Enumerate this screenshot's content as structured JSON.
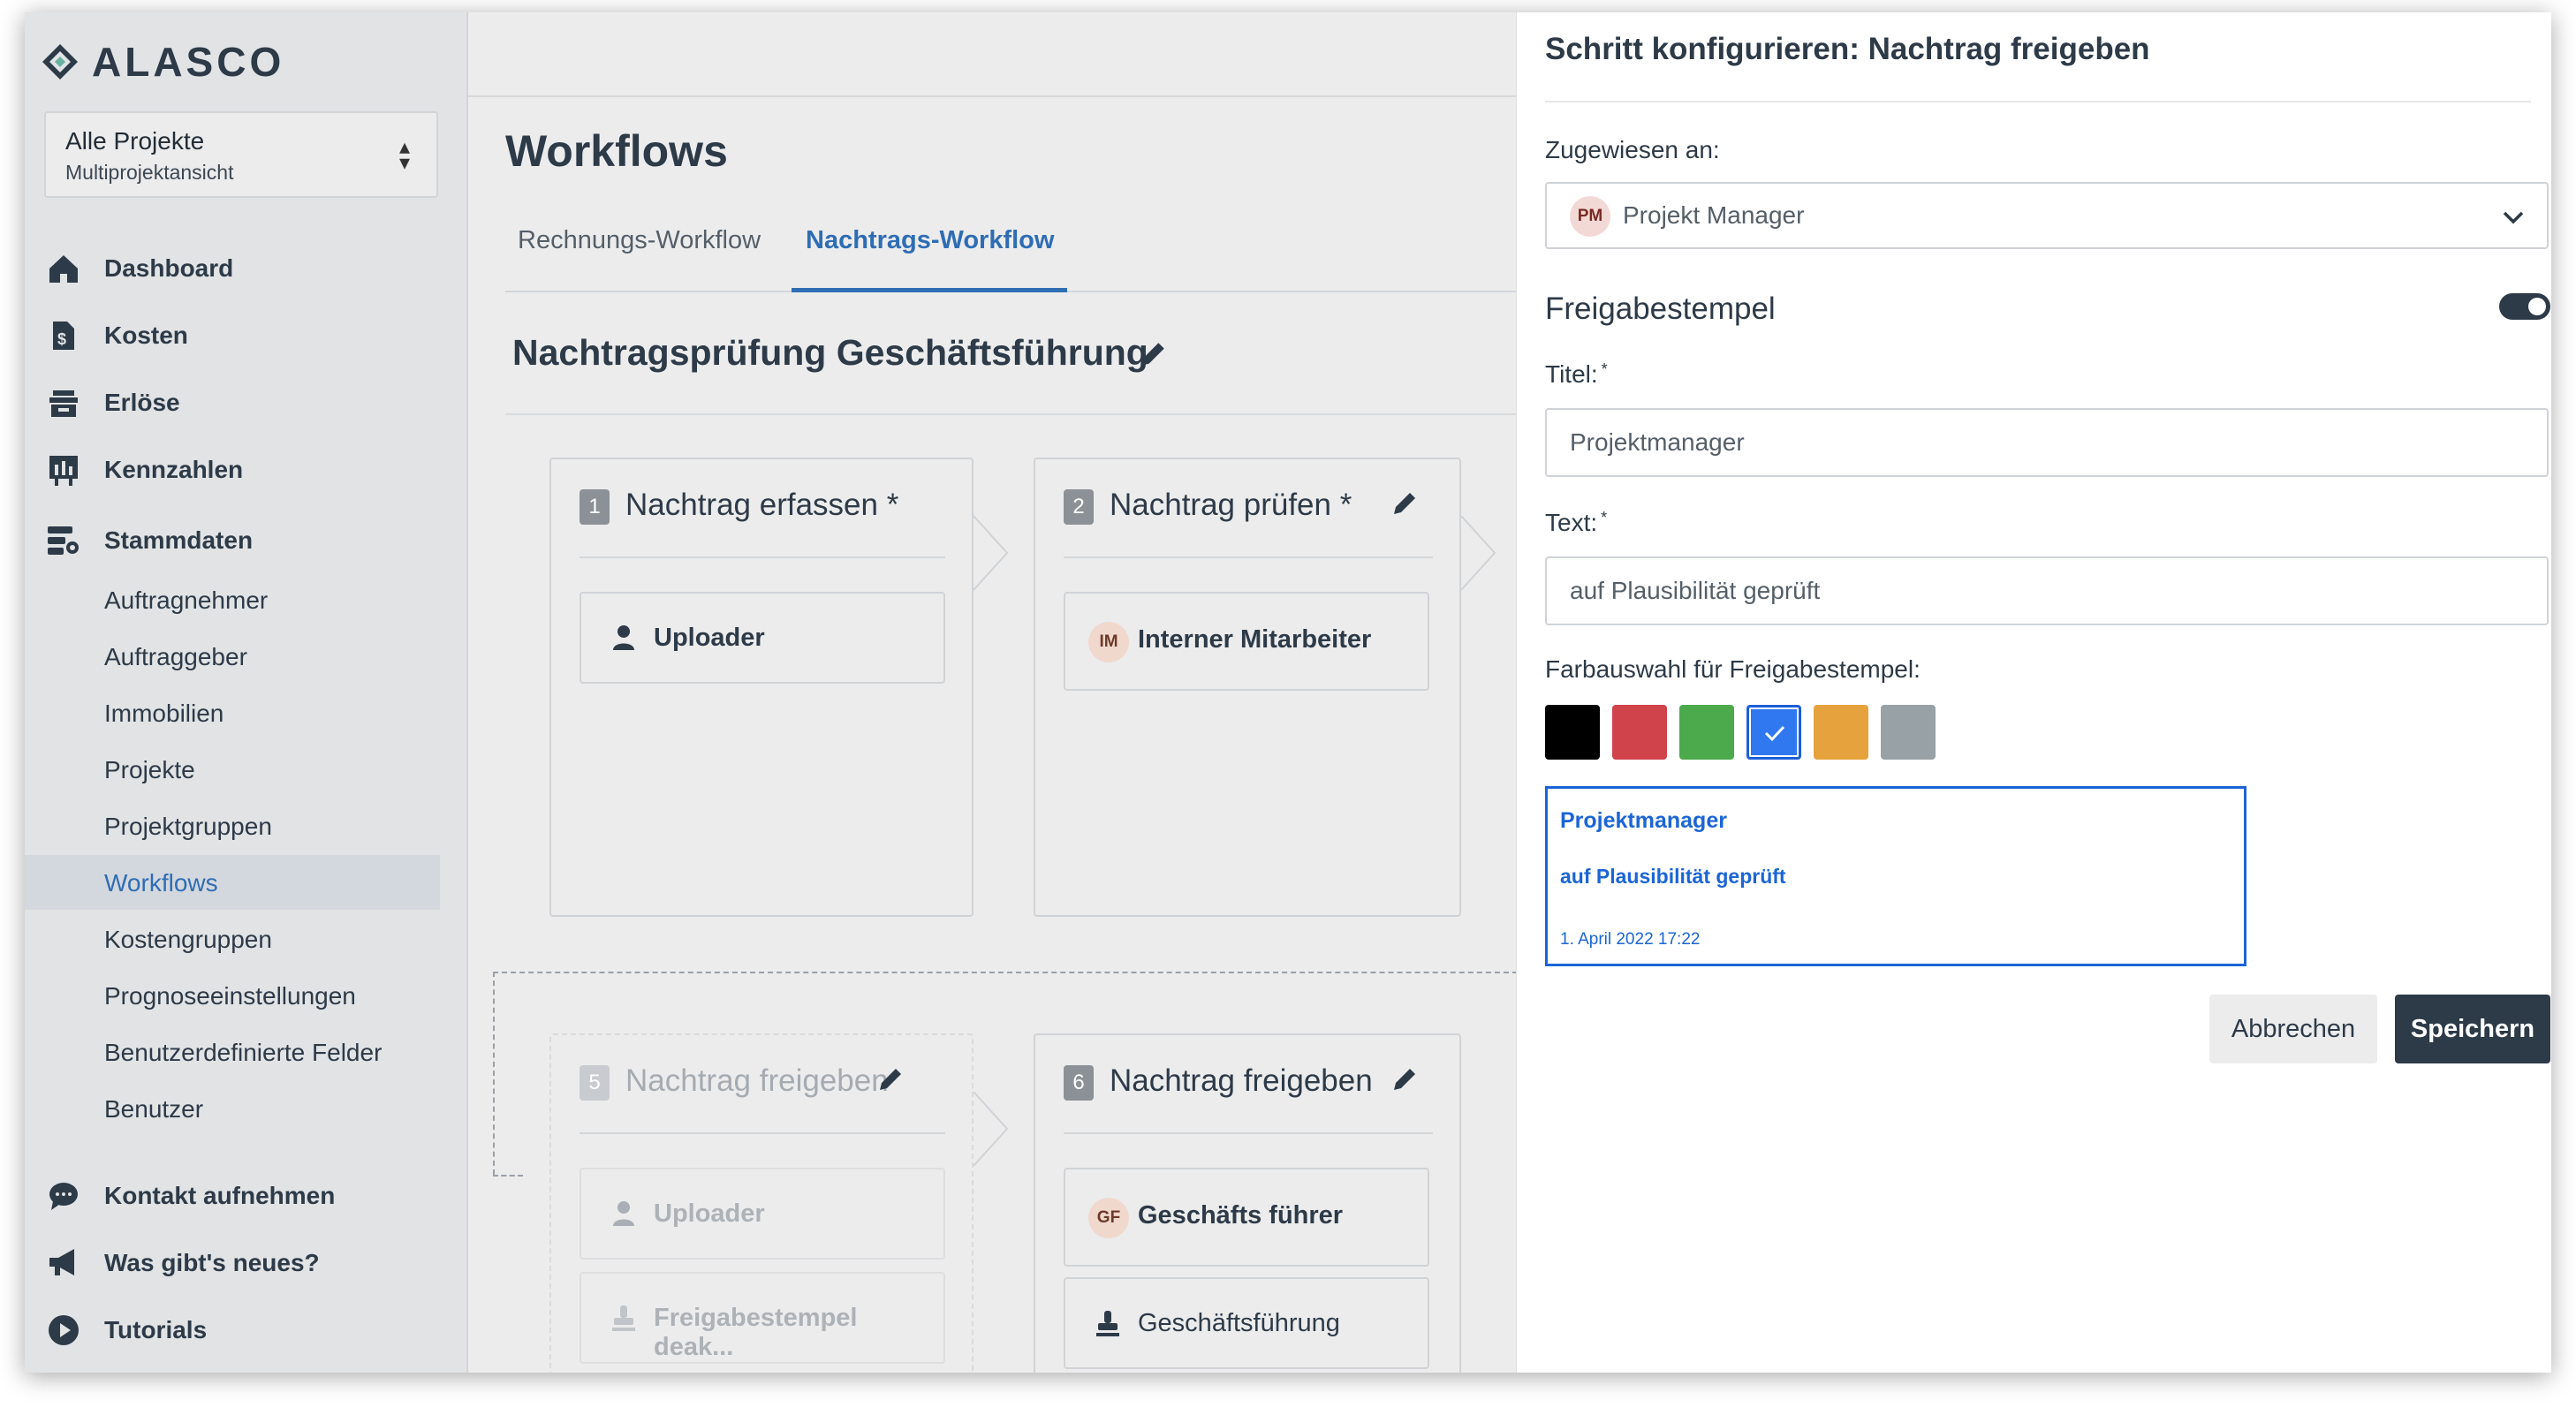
{
  "app": {
    "logo_text": "ALASCO"
  },
  "project_selector": {
    "title": "Alle Projekte",
    "subtitle": "Multiprojektansicht"
  },
  "sidebar": {
    "items": [
      {
        "label": "Dashboard",
        "icon": "home-icon"
      },
      {
        "label": "Kosten",
        "icon": "costs-icon"
      },
      {
        "label": "Erlöse",
        "icon": "revenue-icon"
      },
      {
        "label": "Kennzahlen",
        "icon": "kpi-chart-icon"
      },
      {
        "label": "Stammdaten",
        "icon": "master-data-icon"
      }
    ],
    "subitems": [
      "Auftragnehmer",
      "Auftraggeber",
      "Immobilien",
      "Projekte",
      "Projektgruppen",
      "Workflows",
      "Kostengruppen",
      "Prognoseeinstellungen",
      "Benutzerdefinierte Felder",
      "Benutzer"
    ],
    "active_subitem": "Workflows",
    "bottom": [
      {
        "label": "Kontakt aufnehmen",
        "icon": "chat-icon"
      },
      {
        "label": "Was gibt's neues?",
        "icon": "megaphone-icon"
      },
      {
        "label": "Tutorials",
        "icon": "play-icon"
      }
    ]
  },
  "main": {
    "title": "Workflows",
    "tabs": [
      {
        "label": "Rechnungs-Workflow"
      },
      {
        "label": "Nachtrags-Workflow",
        "active": true
      }
    ],
    "workflow_name": "Nachtragsprüfung Geschäftsführung",
    "steps": [
      {
        "num": "1",
        "title": "Nachtrag erfassen *",
        "cards": [
          {
            "label": "Uploader",
            "icon": "user-icon"
          }
        ]
      },
      {
        "num": "2",
        "title": "Nachtrag prüfen *",
        "cards": [
          {
            "label": "Interner Mitarbeiter",
            "avatar": "IM"
          }
        ]
      },
      {
        "num": "5",
        "title": "Nachtrag freigeben",
        "disabled": true,
        "cards": [
          {
            "label": "Uploader",
            "icon": "user-icon"
          },
          {
            "label": "Freigabestempel deak...",
            "icon": "stamp-icon"
          }
        ]
      },
      {
        "num": "6",
        "title": "Nachtrag freigeben",
        "cards": [
          {
            "label": "Geschäfts führer",
            "avatar": "GF"
          },
          {
            "label": "Geschäftsführung",
            "icon": "stamp-icon"
          }
        ]
      }
    ]
  },
  "panel": {
    "title": "Schritt konfigurieren: Nachtrag freigeben",
    "assigned_label": "Zugewiesen an:",
    "assigned_avatar": "PM",
    "assigned_value": "Projekt Manager",
    "stamp_section": "Freigabestempel",
    "stamp_enabled": true,
    "title_label": "Titel:",
    "title_value": "Projektmanager",
    "text_label": "Text:",
    "text_value": "auf Plausibilität geprüft",
    "color_label": "Farbauswahl für Freigabestempel:",
    "colors": [
      "#000000",
      "#d1434b",
      "#4caa4c",
      "#2f78f0",
      "#e6a23c",
      "#98a2a6"
    ],
    "selected_color": "#2f78f0",
    "preview": {
      "title": "Projektmanager",
      "text": "auf Plausibilität geprüft",
      "date": "1. April 2022 17:22"
    },
    "cancel_label": "Abbrechen",
    "save_label": "Speichern"
  }
}
